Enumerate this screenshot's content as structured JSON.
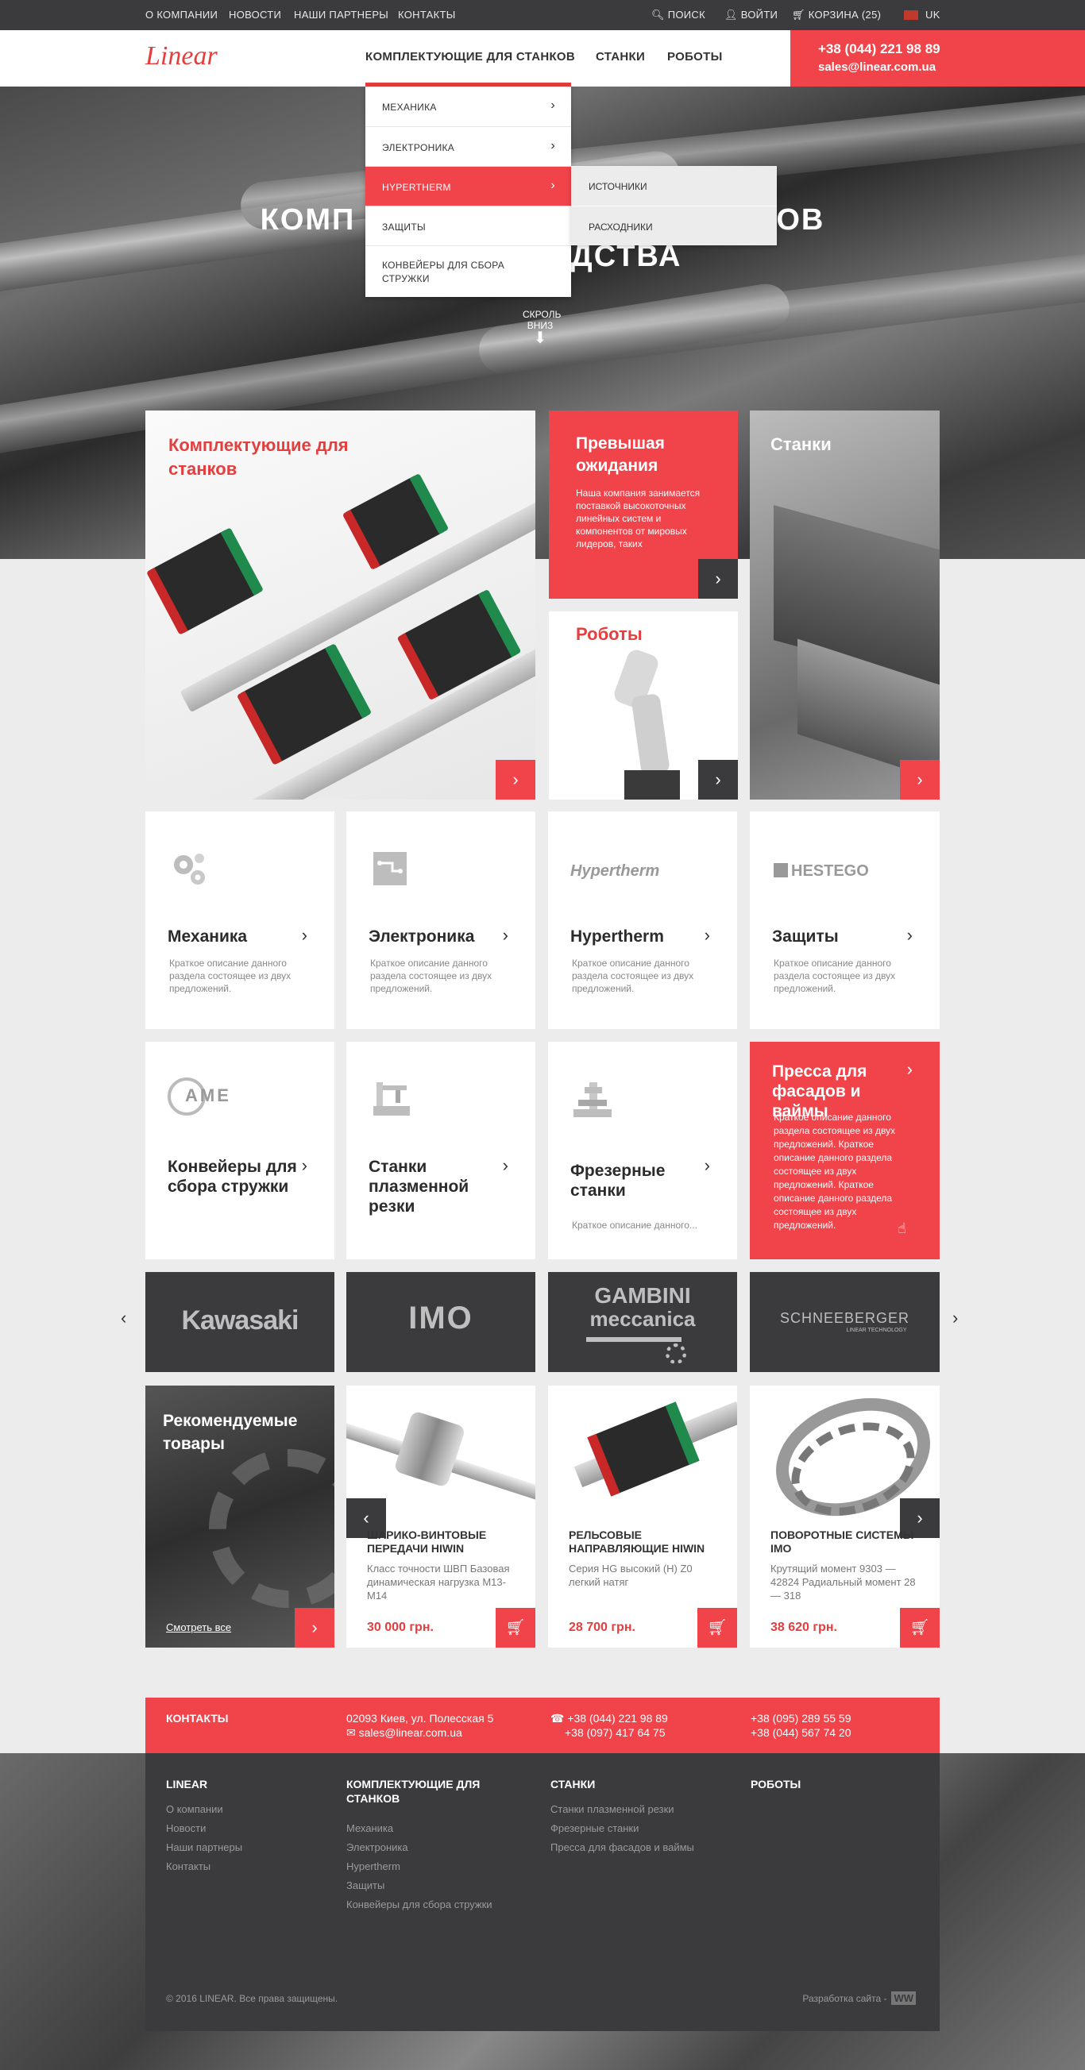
{
  "topbar": {
    "links": [
      "О КОМПАНИИ",
      "НОВОСТИ",
      "НАШИ ПАРТНЕРЫ",
      "КОНТАКТЫ"
    ],
    "search": "ПОИСК",
    "login": "ВОЙТИ",
    "cart": "КОРЗИНА (25)",
    "lang": "UK"
  },
  "header": {
    "logo": "Linear",
    "nav": [
      "КОМПЛЕКТУЮЩИЕ ДЛЯ СТАНКОВ",
      "СТАНКИ",
      "РОБОТЫ"
    ],
    "phone": "+38 (044) 221 98 89",
    "email": "sales@linear.com.ua"
  },
  "dropdown": {
    "items": [
      "МЕХАНИКА",
      "ЭЛЕКТРОНИКА",
      "HYPERTHERM",
      "ЗАЩИТЫ",
      "КОНВЕЙЕРЫ ДЛЯ СБОРА СТРУЖКИ"
    ],
    "submenu": [
      "ИСТОЧНИКИ",
      "РАСХОДНИКИ"
    ]
  },
  "hero": {
    "line1_left": "КОМП",
    "line1_right": "ОВ",
    "line2": "ОДСТВА",
    "scroll": "СКРОЛЬ ВНИЗ"
  },
  "tiles": {
    "components": "Комплектующие для станков",
    "exceed_title": "Превышая ожидания",
    "exceed_text": "Наша компания занимается поставкой высокоточных линейных систем и компонентов от мировых лидеров, таких",
    "robots": "Роботы",
    "machines": "Станки"
  },
  "categories": [
    {
      "title": "Механика",
      "desc": "Краткое описание данного раздела состоящее из двух предложений.",
      "icon": "gears-icon"
    },
    {
      "title": "Электроника",
      "desc": "Краткое описание данного раздела состоящее из двух предложений.",
      "icon": "circuit-icon"
    },
    {
      "title": "Hypertherm",
      "desc": "Краткое описание данного раздела состоящее из двух предложений.",
      "icon": "hypertherm-logo"
    },
    {
      "title": "Защиты",
      "desc": "Краткое описание данного раздела состоящее из двух предложений.",
      "icon": "hestego-logo"
    },
    {
      "title": "Конвейеры для сбора стружки",
      "desc": "",
      "icon": "ame-logo"
    },
    {
      "title": "Станки плазменной резки",
      "desc": "",
      "icon": "plasma-machine-icon"
    },
    {
      "title": "Фрезерные станки",
      "desc": "Краткое описание данного...",
      "icon": "milling-machine-icon"
    },
    {
      "title": "Пресса для фасадов и ваймы",
      "desc": "Краткое описание данного раздела состоящее из двух предложений. Краткое описание данного раздела состоящее из двух предложений. Краткое описание данного раздела состоящее из двух предложений.",
      "icon": ""
    }
  ],
  "logos": {
    "hypertherm": "Hypertherm",
    "hestego": "HESTEGO",
    "ame": "AME"
  },
  "brands": [
    "Kawasaki",
    "IMO",
    "GAMBINI",
    "meccanica",
    "SCHNEEBERGER",
    "LINEAR TECHNOLOGY"
  ],
  "recommended": {
    "title": "Рекомендуемые товары",
    "link": "Смотреть все"
  },
  "products": [
    {
      "name": "ШАРИКО-ВИНТОВЫЕ ПЕРЕДАЧИ HIWIN",
      "desc": "Класс точности ШВП Базовая динамическая нагрузка М13-М14",
      "price": "30 000 грн."
    },
    {
      "name": "РЕЛЬСОВЫЕ НАПРАВЛЯЮЩИЕ HIWIN",
      "desc": "Серия HG высокий (H) Z0 легкий натяг",
      "price": "28 700 грн."
    },
    {
      "name": "ПОВОРОТНЫЕ СИСТЕМЫ IMO",
      "desc": "Крутящий момент 9303 — 42824 Радиальный момент 28 — 318",
      "price": "38 620 грн."
    }
  ],
  "contacts": {
    "label": "КОНТАКТЫ",
    "address": "02093 Киев, ул. Полесская 5",
    "email": "sales@linear.com.ua",
    "phone1": "+38 (044) 221 98 89",
    "phone2": "+38 (097) 417 64 75",
    "phone3": "+38 (095) 289 55 59",
    "phone4": "+38 (044) 567 74 20"
  },
  "footer": {
    "col1_title": "LINEAR",
    "col1": [
      "О компании",
      "Новости",
      "Наши партнеры",
      "Контакты"
    ],
    "col2_title": "КОМПЛЕКТУЮЩИЕ ДЛЯ СТАНКОВ",
    "col2": [
      "Механика",
      "Электроника",
      "Hypertherm",
      "Защиты",
      "Конвейеры для сбора стружки"
    ],
    "col3_title": "СТАНКИ",
    "col3": [
      "Станки плазменной резки",
      "Фрезерные станки",
      "Пресса для фасадов и ваймы"
    ],
    "col4_title": "РОБОТЫ",
    "copyright": "© 2016 LINEAR. Все права защищены.",
    "dev": "Разработка сайта -",
    "dev_logo": "WW"
  },
  "colors": {
    "accent": "#f0434a",
    "dark": "#3b3b3d"
  }
}
